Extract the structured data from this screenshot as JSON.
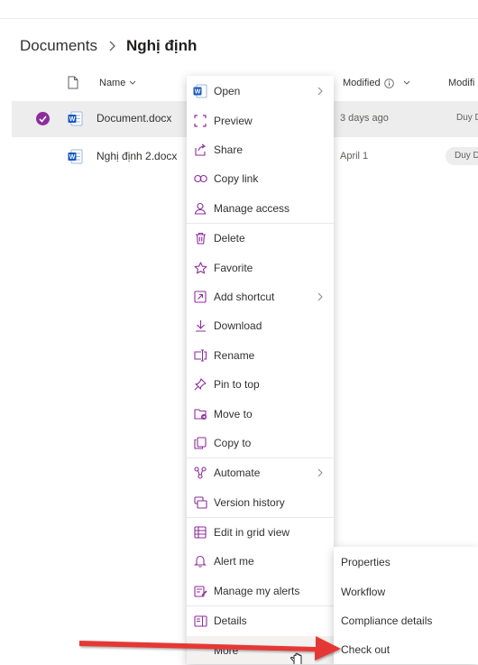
{
  "breadcrumb": {
    "root": "Documents",
    "current": "Nghị định"
  },
  "columns": {
    "name": "Name",
    "modified": "Modified",
    "modified_by": "Modifi"
  },
  "files": [
    {
      "name": "Document.docx",
      "modified": "3 days ago",
      "modified_by": "Duy D",
      "selected": true
    },
    {
      "name": "Nghị định 2.docx",
      "modified": "April 1",
      "modified_by": "Duy D",
      "selected": false
    }
  ],
  "context_menu": {
    "items": [
      {
        "label": "Open",
        "icon": "word-icon"
      },
      {
        "label": "Preview",
        "icon": "preview-icon"
      },
      {
        "label": "Share",
        "icon": "share-icon"
      },
      {
        "label": "Copy link",
        "icon": "link-icon"
      },
      {
        "label": "Manage access",
        "icon": "person-icon"
      },
      {
        "label": "Delete",
        "icon": "trash-icon"
      },
      {
        "label": "Favorite",
        "icon": "star-icon"
      },
      {
        "label": "Add shortcut",
        "icon": "shortcut-icon"
      },
      {
        "label": "Download",
        "icon": "download-icon"
      },
      {
        "label": "Rename",
        "icon": "rename-icon"
      },
      {
        "label": "Pin to top",
        "icon": "pin-icon"
      },
      {
        "label": "Move to",
        "icon": "move-icon"
      },
      {
        "label": "Copy to",
        "icon": "copy-icon"
      },
      {
        "label": "Automate",
        "icon": "automate-icon"
      },
      {
        "label": "Version history",
        "icon": "history-icon"
      },
      {
        "label": "Edit in grid view",
        "icon": "grid-icon"
      },
      {
        "label": "Alert me",
        "icon": "bell-icon"
      },
      {
        "label": "Manage my alerts",
        "icon": "manage-alerts-icon"
      },
      {
        "label": "Details",
        "icon": "details-icon"
      },
      {
        "label": "More",
        "icon": ""
      }
    ]
  },
  "more_submenu": {
    "items": [
      {
        "label": "Properties"
      },
      {
        "label": "Workflow"
      },
      {
        "label": "Compliance details"
      },
      {
        "label": "Check out"
      }
    ]
  },
  "colors": {
    "accent": "#8d2d9d",
    "word_blue": "#185abd",
    "annotation_arrow": "#e53935",
    "selected_row": "#ededed"
  }
}
